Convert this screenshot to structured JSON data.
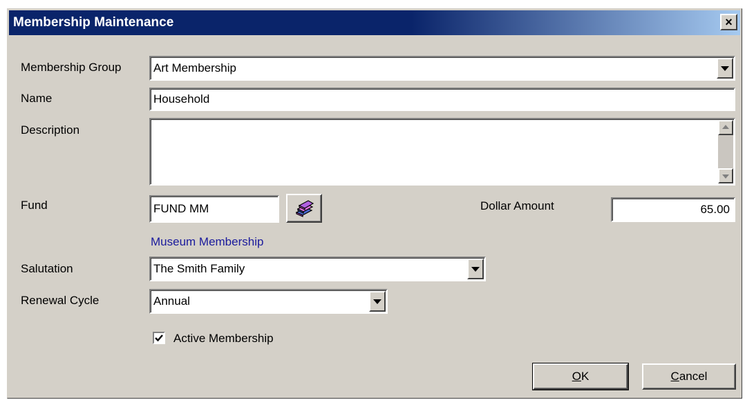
{
  "window": {
    "title": "Membership Maintenance",
    "close_glyph": "×"
  },
  "form": {
    "membership_group": {
      "label": "Membership Group",
      "value": "Art Membership"
    },
    "name": {
      "label": "Name",
      "value": "Household"
    },
    "description": {
      "label": "Description",
      "value": ""
    },
    "fund": {
      "label": "Fund",
      "value": "FUND MM",
      "lookup_icon": "books-lookup-icon",
      "fund_name": "Museum Membership"
    },
    "dollar_amount": {
      "label": "Dollar Amount",
      "value": "65.00"
    },
    "salutation": {
      "label": "Salutation",
      "value": "The Smith Family"
    },
    "renewal_cycle": {
      "label": "Renewal Cycle",
      "value": "Annual"
    },
    "active_membership": {
      "label": "Active Membership",
      "checked": true
    }
  },
  "buttons": {
    "ok": {
      "mnemonic": "O",
      "rest": "K"
    },
    "cancel": {
      "mnemonic": "C",
      "rest": "ancel"
    }
  },
  "colors": {
    "titlebar_start": "#0a246a",
    "titlebar_end": "#a6caf0",
    "dialog_bg": "#d4d0c8",
    "link": "#1a1a9c"
  }
}
